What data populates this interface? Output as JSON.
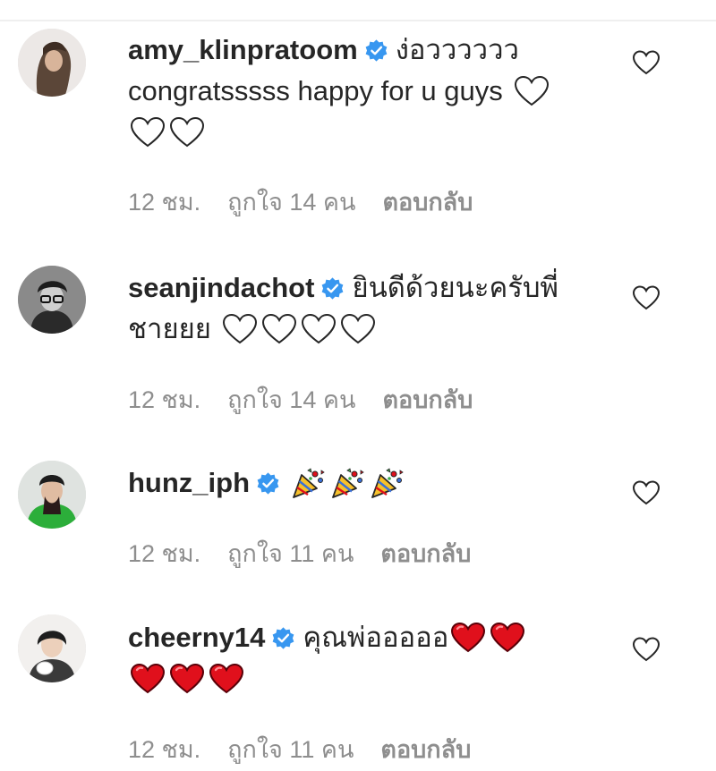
{
  "comments": [
    {
      "username": "amy_klinpratoom",
      "line1_text": "ง่อวววววว",
      "line2_text": "congratsssss happy for u guys",
      "emojis_line2": [
        "white-heart"
      ],
      "emojis_line3": [
        "white-heart",
        "white-heart"
      ],
      "time": "12 ชม.",
      "likes": "ถูกใจ 14 คน",
      "reply": "ตอบกลับ"
    },
    {
      "username": "seanjindachot",
      "line1_text": "ยินดีด้วยนะครับพี่",
      "line2_text": "ชายยย",
      "emojis_line2": [
        "white-heart",
        "white-heart",
        "white-heart",
        "white-heart"
      ],
      "time": "12 ชม.",
      "likes": "ถูกใจ 14 คน",
      "reply": "ตอบกลับ"
    },
    {
      "username": "hunz_iph",
      "emojis_line1": [
        "party-popper",
        "party-popper",
        "party-popper"
      ],
      "time": "12 ชม.",
      "likes": "ถูกใจ 11 คน",
      "reply": "ตอบกลับ"
    },
    {
      "username": "cheerny14",
      "line1_text": "คุณพ่อออออ",
      "emojis_line1": [
        "red-heart",
        "red-heart"
      ],
      "emojis_line2": [
        "red-heart",
        "red-heart",
        "red-heart"
      ],
      "time": "12 ชม.",
      "likes": "ถูกใจ 11 คน",
      "reply": "ตอบกลับ"
    }
  ],
  "colors": {
    "text": "#262626",
    "meta": "#8e8e8e",
    "verified": "#3897f0",
    "red_heart": "#e0101c"
  }
}
